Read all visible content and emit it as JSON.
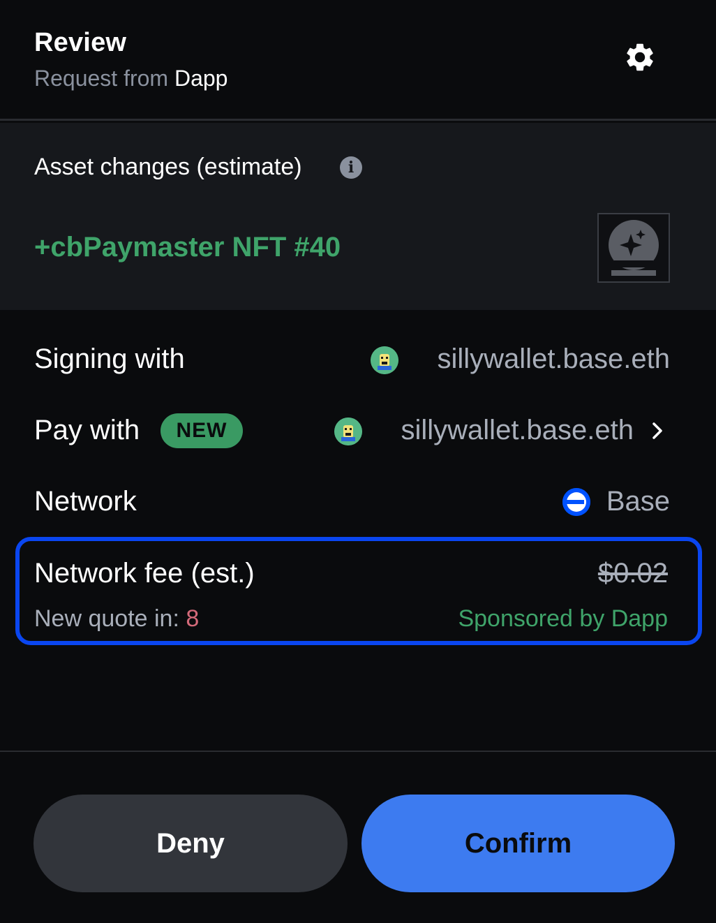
{
  "header": {
    "title": "Review",
    "subtitle_prefix": "Request from ",
    "subtitle_dapp": "Dapp",
    "settings_icon": "gear-icon"
  },
  "asset_changes": {
    "title": "Asset changes (estimate)",
    "info_icon": "info-icon",
    "nft_name": "+cbPaymaster NFT #40",
    "nft_thumbnail_icon": "sparkle-orb-icon"
  },
  "signing": {
    "label": "Signing with",
    "account": "sillywallet.base.eth"
  },
  "pay": {
    "label": "Pay with",
    "badge": "NEW",
    "account": "sillywallet.base.eth"
  },
  "network": {
    "label": "Network",
    "value": "Base"
  },
  "fee": {
    "label": "Network fee (est.)",
    "original_amount": "$0.02",
    "quote_label": "New quote in: ",
    "quote_countdown": "8",
    "sponsored_text": "Sponsored by Dapp"
  },
  "actions": {
    "deny_label": "Deny",
    "confirm_label": "Confirm"
  },
  "colors": {
    "background": "#0a0b0d",
    "section_bg": "#16181c",
    "accent_green": "#3fa46a",
    "highlight_border": "#0a46f0",
    "confirm_blue": "#3d7bf0",
    "countdown_red": "#d46a7a"
  }
}
